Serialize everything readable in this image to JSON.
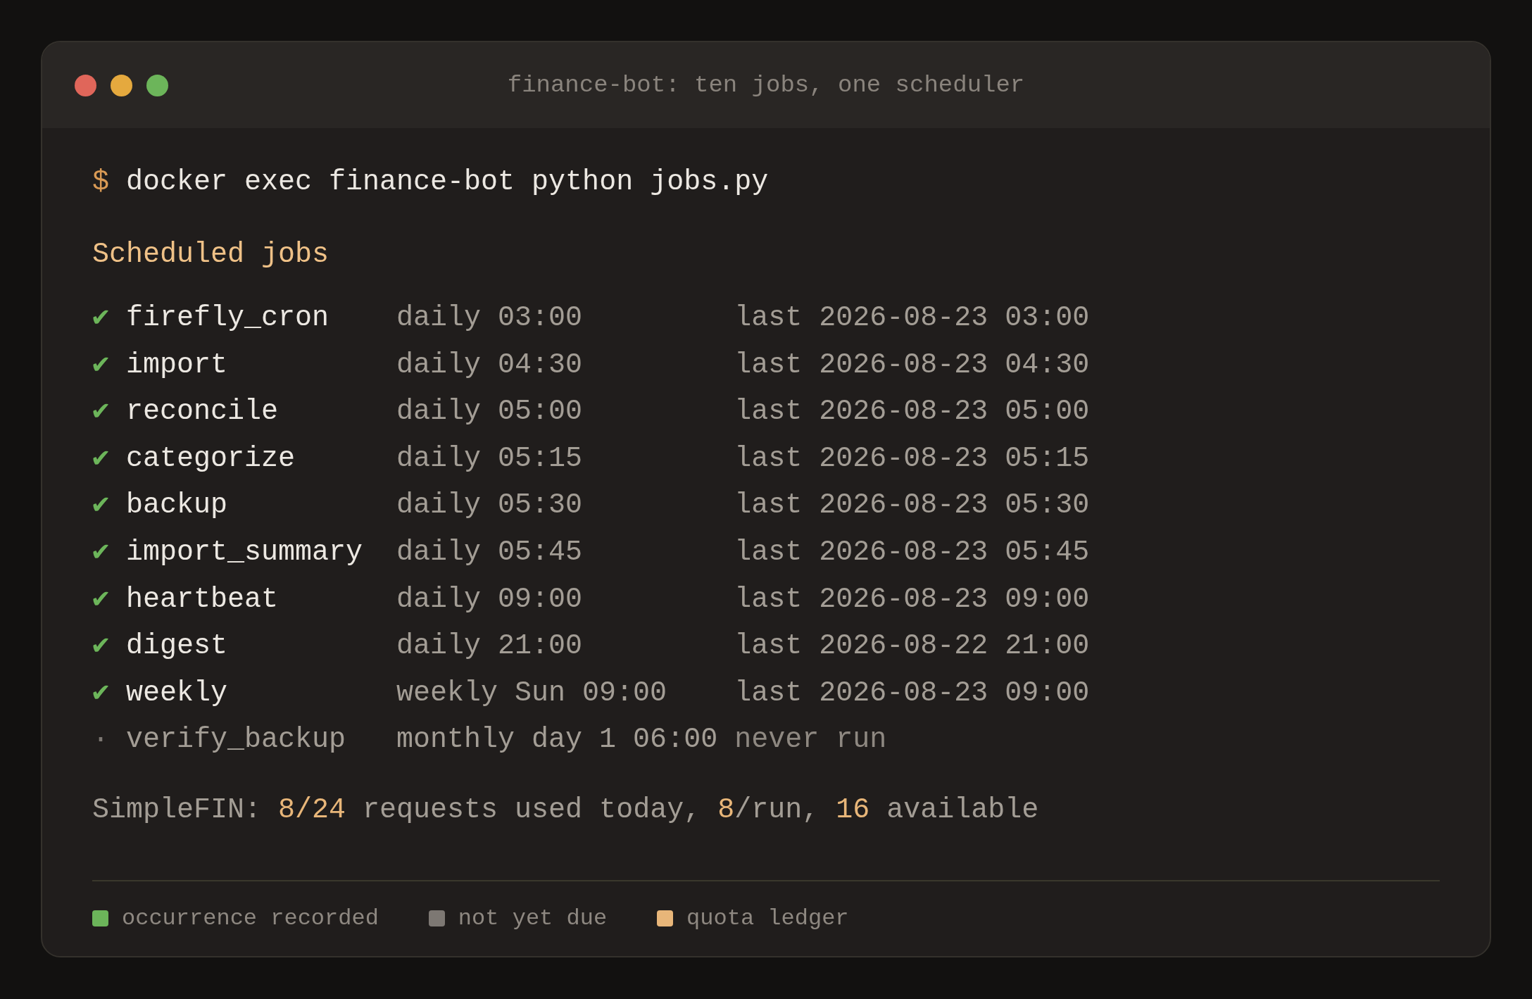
{
  "window": {
    "title": "finance-bot: ten jobs, one scheduler"
  },
  "command": {
    "prompt": "$",
    "text": "docker exec finance-bot python jobs.py"
  },
  "heading": "Scheduled jobs",
  "jobs": [
    {
      "done": true,
      "marker": "✔",
      "name": "firefly_cron",
      "schedule": "daily 03:00",
      "last": "last 2026-08-23 03:00"
    },
    {
      "done": true,
      "marker": "✔",
      "name": "import",
      "schedule": "daily 04:30",
      "last": "last 2026-08-23 04:30"
    },
    {
      "done": true,
      "marker": "✔",
      "name": "reconcile",
      "schedule": "daily 05:00",
      "last": "last 2026-08-23 05:00"
    },
    {
      "done": true,
      "marker": "✔",
      "name": "categorize",
      "schedule": "daily 05:15",
      "last": "last 2026-08-23 05:15"
    },
    {
      "done": true,
      "marker": "✔",
      "name": "backup",
      "schedule": "daily 05:30",
      "last": "last 2026-08-23 05:30"
    },
    {
      "done": true,
      "marker": "✔",
      "name": "import_summary",
      "schedule": "daily 05:45",
      "last": "last 2026-08-23 05:45"
    },
    {
      "done": true,
      "marker": "✔",
      "name": "heartbeat",
      "schedule": "daily 09:00",
      "last": "last 2026-08-23 09:00"
    },
    {
      "done": true,
      "marker": "✔",
      "name": "digest",
      "schedule": "daily 21:00",
      "last": "last 2026-08-22 21:00"
    },
    {
      "done": true,
      "marker": "✔",
      "name": "weekly",
      "schedule": "weekly Sun 09:00",
      "last": "last 2026-08-23 09:00"
    },
    {
      "done": false,
      "marker": "·",
      "name": "verify_backup",
      "schedule": "monthly day 1 06:00",
      "last": "never run"
    }
  ],
  "quota": [
    {
      "text": "SimpleFIN: ",
      "highlight": false
    },
    {
      "text": "8/24",
      "highlight": true
    },
    {
      "text": " requests used today, ",
      "highlight": false
    },
    {
      "text": "8",
      "highlight": true
    },
    {
      "text": "/run, ",
      "highlight": false
    },
    {
      "text": "16",
      "highlight": true
    },
    {
      "text": " available",
      "highlight": false
    }
  ],
  "legend": [
    {
      "label": "occurrence recorded",
      "color": "#6cb55a"
    },
    {
      "label": "not yet due",
      "color": "#7d7873"
    },
    {
      "label": "quota ledger",
      "color": "#e8b679"
    }
  ]
}
